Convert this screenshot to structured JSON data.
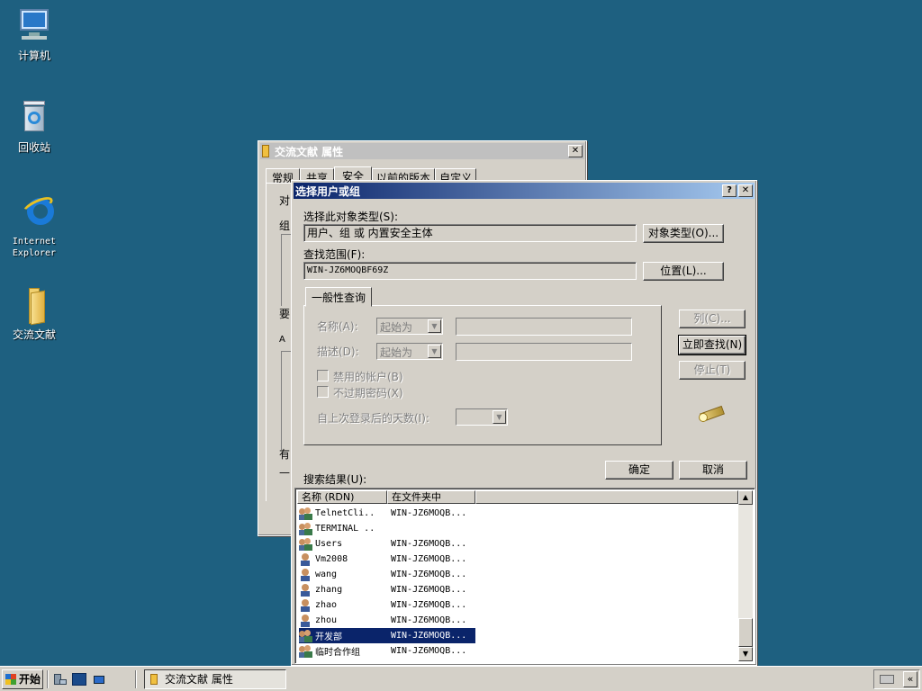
{
  "desktop": {
    "icons": [
      {
        "label": "计算机",
        "icon": "computer-icon"
      },
      {
        "label": "回收站",
        "icon": "recycle-bin-icon"
      },
      {
        "label": "Internet Explorer",
        "icon": "internet-explorer-icon"
      },
      {
        "label": "交流文献",
        "icon": "folder-icon"
      }
    ]
  },
  "properties_window": {
    "title": "交流文献 属性",
    "tabs": [
      "常规",
      "共享",
      "安全",
      "以前的版本",
      "自定义"
    ],
    "active_tab": "安全",
    "visible_fragments": [
      "对",
      "组",
      "要",
      "A",
      "有",
      "—"
    ]
  },
  "dialog": {
    "title": "选择用户或组",
    "help_btn": "?",
    "close_btn": "✕",
    "object_type_label": "选择此对象类型(S):",
    "object_type_value": "用户、组 或 内置安全主体",
    "object_type_btn": "对象类型(O)...",
    "location_label": "查找范围(F):",
    "location_value": "WIN-JZ6MOQBF69Z",
    "location_btn": "位置(L)...",
    "query_tab": "一般性查询",
    "name_label": "名称(A):",
    "name_mode": "起始为",
    "desc_label": "描述(D):",
    "desc_mode": "起始为",
    "disabled_accounts": "禁用的帐户(B)",
    "non_expiring_pwd": "不过期密码(X)",
    "days_since_logon": "自上次登录后的天数(I):",
    "columns_btn": "列(C)...",
    "find_now_btn": "立即查找(N)",
    "stop_btn": "停止(T)",
    "ok_btn": "确定",
    "cancel_btn": "取消",
    "results_label": "搜索结果(U):",
    "results_headers": [
      "名称 (RDN)",
      "在文件夹中"
    ],
    "results": [
      {
        "name": "TelnetCli...",
        "folder": "WIN-JZ6MOQB...",
        "kind": "group"
      },
      {
        "name": "TERMINAL ...",
        "folder": "",
        "kind": "group"
      },
      {
        "name": "Users",
        "folder": "WIN-JZ6MOQB...",
        "kind": "group"
      },
      {
        "name": "Vm2008",
        "folder": "WIN-JZ6MOQB...",
        "kind": "user"
      },
      {
        "name": "wang",
        "folder": "WIN-JZ6MOQB...",
        "kind": "user"
      },
      {
        "name": "zhang",
        "folder": "WIN-JZ6MOQB...",
        "kind": "user"
      },
      {
        "name": "zhao",
        "folder": "WIN-JZ6MOQB...",
        "kind": "user"
      },
      {
        "name": "zhou",
        "folder": "WIN-JZ6MOQB...",
        "kind": "user"
      },
      {
        "name": "开发部",
        "folder": "WIN-JZ6MOQB...",
        "kind": "group",
        "selected": true
      },
      {
        "name": "临时合作组",
        "folder": "WIN-JZ6MOQB...",
        "kind": "group"
      }
    ]
  },
  "taskbar": {
    "start_label": "开始",
    "task_label": "交流文献 属性",
    "quicklaunch": [
      "server-manager-icon",
      "powershell-icon",
      "show-desktop-icon"
    ],
    "tray": [
      "keyboard-icon",
      "expand-tray-icon"
    ],
    "tray_expand": "«"
  }
}
